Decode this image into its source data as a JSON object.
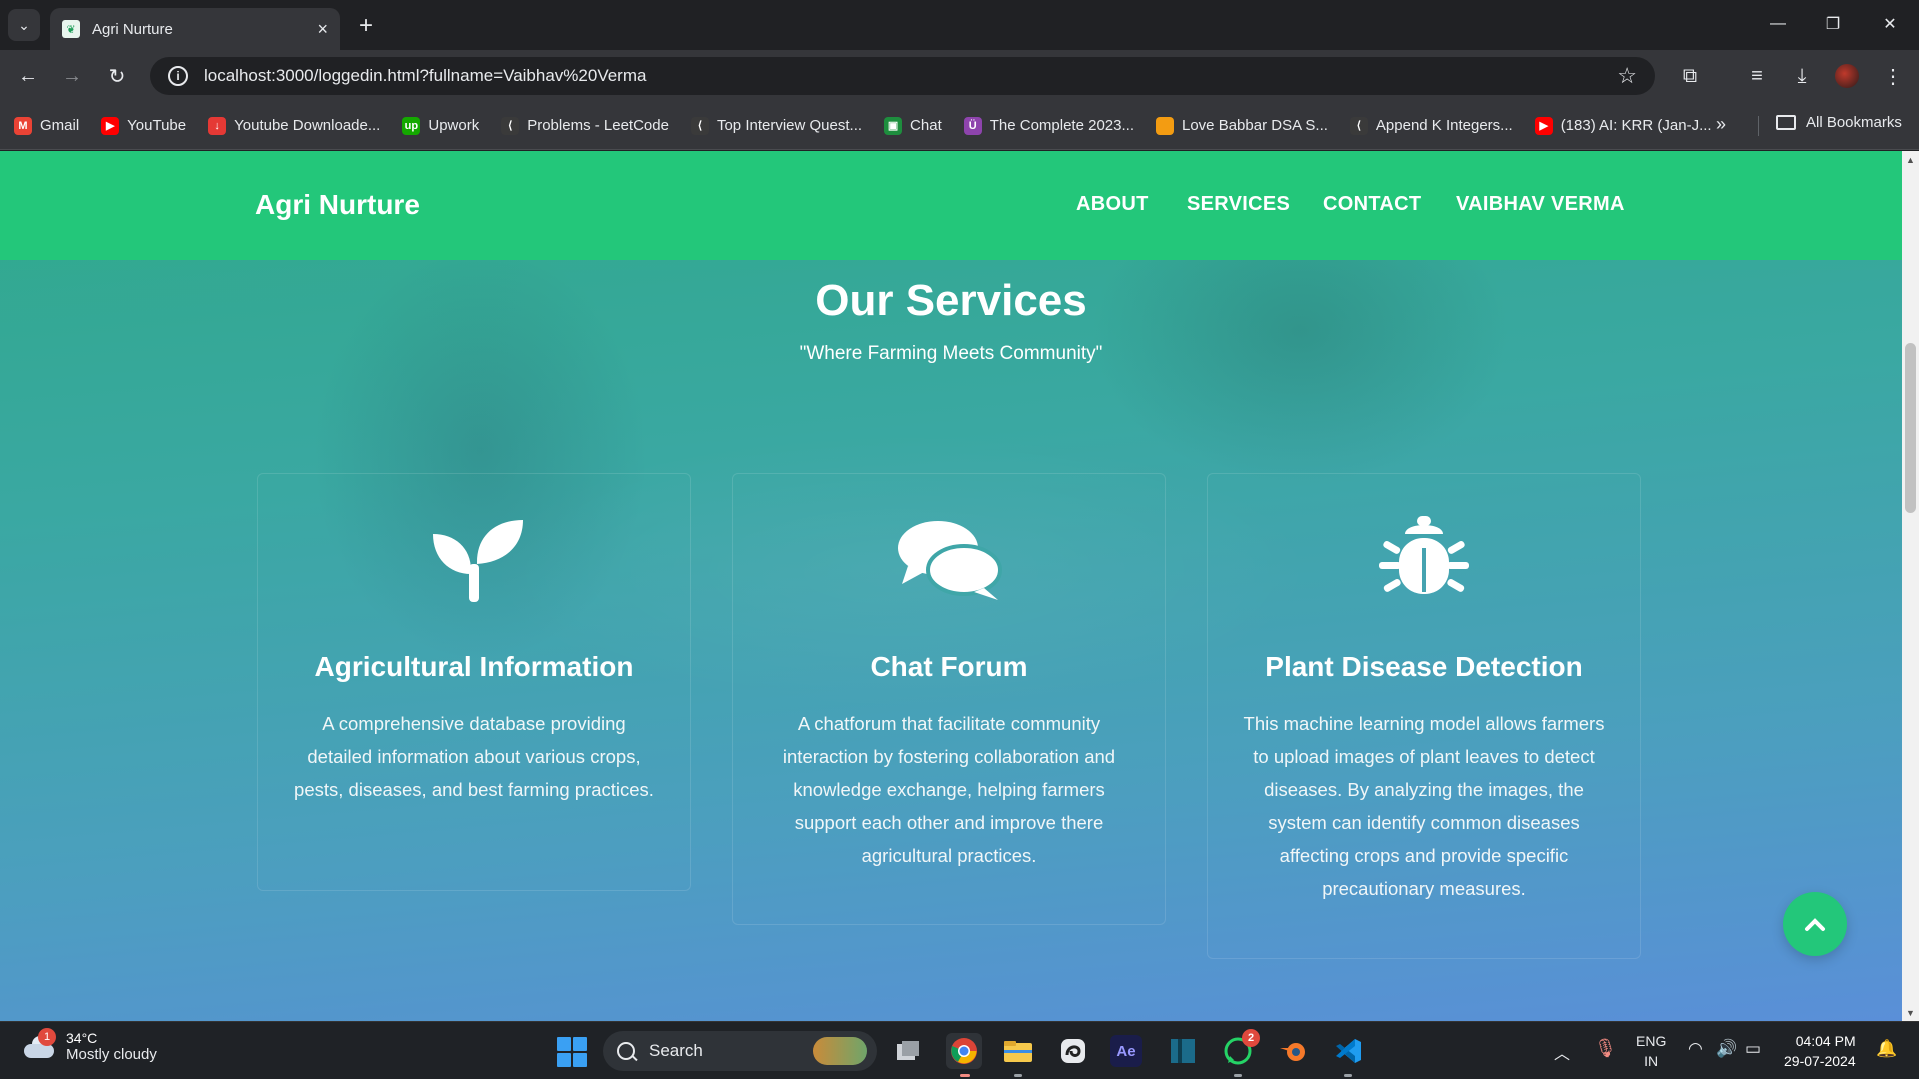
{
  "browser": {
    "tab_title": "Agri Nurture",
    "url": "localhost:3000/loggedin.html?fullname=Vaibhav%20Verma",
    "bookmarks": [
      {
        "label": "Gmail",
        "color": "#ea4335",
        "icon": "M"
      },
      {
        "label": "YouTube",
        "color": "#ff0000",
        "icon": "▶"
      },
      {
        "label": "Youtube Downloade...",
        "color": "#e53935",
        "icon": "↓"
      },
      {
        "label": "Upwork",
        "color": "#14a800",
        "icon": "up"
      },
      {
        "label": "Problems - LeetCode",
        "color": "#3a3a3a",
        "icon": "⟨"
      },
      {
        "label": "Top Interview Quest...",
        "color": "#3a3a3a",
        "icon": "⟨"
      },
      {
        "label": "Chat",
        "color": "#1e8e3e",
        "icon": "▣"
      },
      {
        "label": "The Complete 2023...",
        "color": "#8e44ad",
        "icon": "Ü"
      },
      {
        "label": "Love Babbar DSA S...",
        "color": "#f39c12",
        "icon": ""
      },
      {
        "label": "Append K Integers...",
        "color": "#3a3a3a",
        "icon": "⟨"
      },
      {
        "label": "(183) AI: KRR (Jan-J...",
        "color": "#ff0000",
        "icon": "▶"
      }
    ],
    "all_bookmarks_label": "All Bookmarks"
  },
  "site": {
    "brand": "Agri Nurture",
    "nav": [
      "ABOUT",
      "SERVICES",
      "CONTACT",
      "VAIBHAV VERMA"
    ],
    "section_title": "Our Services",
    "section_subtitle": "\"Where Farming Meets Community\"",
    "cards": [
      {
        "icon": "seedling-icon",
        "title": "Agricultural Information",
        "text": "A comprehensive database providing detailed information about various crops, pests, diseases, and best farming practices."
      },
      {
        "icon": "comments-icon",
        "title": "Chat Forum",
        "text": "A chatforum that facilitate community interaction by fostering collaboration and knowledge exchange, helping farmers support each other and improve there agricultural practices."
      },
      {
        "icon": "bug-icon",
        "title": "Plant Disease Detection",
        "text": "This machine learning model allows farmers to upload images of plant leaves to detect diseases. By analyzing the images, the system can identify common diseases affecting crops and provide specific precautionary measures."
      }
    ],
    "accent_color": "#23c77a"
  },
  "taskbar": {
    "weather_badge": "1",
    "temperature": "34°C",
    "condition": "Mostly cloudy",
    "search_label": "Search",
    "whatsapp_badge": "2",
    "language": "ENG",
    "region": "IN",
    "time": "04:04 PM",
    "date": "29-07-2024"
  }
}
